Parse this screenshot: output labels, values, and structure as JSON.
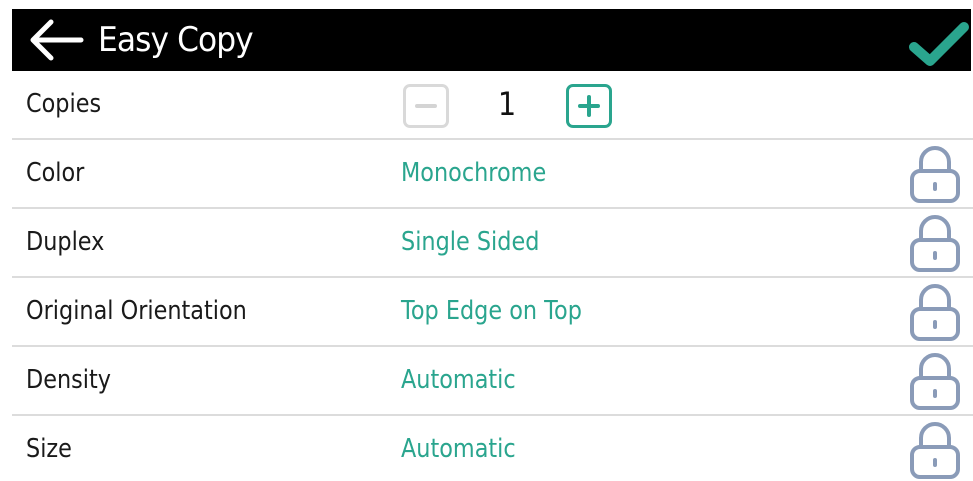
{
  "header": {
    "title": "Easy Copy",
    "back_icon": "arrow-left-icon",
    "confirm_icon": "checkmark-icon",
    "confirm_color": "#2aa58e"
  },
  "copies": {
    "label": "Copies",
    "value": "1",
    "decrement_icon": "minus-icon",
    "increment_icon": "plus-icon"
  },
  "settings": [
    {
      "label": "Color",
      "value": "Monochrome",
      "icon": "lock-icon"
    },
    {
      "label": "Duplex",
      "value": "Single Sided",
      "icon": "lock-icon"
    },
    {
      "label": "Original Orientation",
      "value": "Top Edge on Top",
      "icon": "lock-icon"
    },
    {
      "label": "Density",
      "value": "Automatic",
      "icon": "lock-icon"
    },
    {
      "label": "Size",
      "value": "Automatic",
      "icon": "lock-icon"
    }
  ],
  "colors": {
    "accent": "#2aa58e",
    "header_bg": "#000000",
    "lock": "#8a9bb8",
    "divider": "#dcdcdc"
  }
}
